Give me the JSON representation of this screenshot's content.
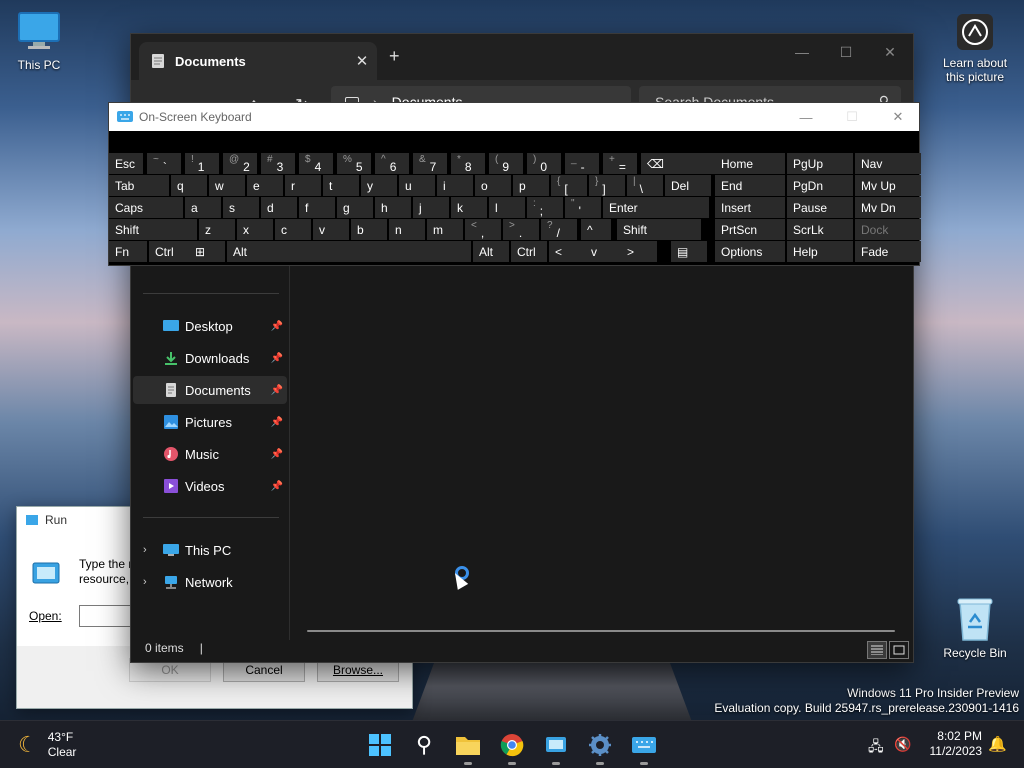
{
  "desktop": {
    "icons": {
      "this_pc": "This PC",
      "learn_picture": "Learn about this picture",
      "recycle_bin": "Recycle Bin"
    },
    "watermark": {
      "line1": "Windows 11 Pro Insider Preview",
      "line2": "Evaluation copy. Build 25947.rs_prerelease.230901-1416"
    }
  },
  "run_dialog": {
    "title": "Run",
    "description_line1": "Type the n",
    "description_line2": "resource,",
    "open_label": "Open:",
    "open_value": "",
    "ok_label": "OK",
    "cancel_label": "Cancel",
    "browse_label": "Browse..."
  },
  "explorer": {
    "tab_title": "Documents",
    "new_tab": "+",
    "address": "Documents",
    "search_placeholder": "Search Documents",
    "sidebar": {
      "quick": [
        {
          "label": "Desktop",
          "icon": "desktop-icon"
        },
        {
          "label": "Downloads",
          "icon": "download-icon"
        },
        {
          "label": "Documents",
          "icon": "document-icon",
          "active": true
        },
        {
          "label": "Pictures",
          "icon": "pictures-icon"
        },
        {
          "label": "Music",
          "icon": "music-icon"
        },
        {
          "label": "Videos",
          "icon": "videos-icon"
        }
      ],
      "roots": [
        {
          "label": "This PC",
          "icon": "this-pc-icon"
        },
        {
          "label": "Network",
          "icon": "network-icon"
        }
      ]
    },
    "status": "0 items",
    "status_sep": "|"
  },
  "osk": {
    "title": "On-Screen Keyboard",
    "rows": [
      [
        {
          "m": "Esc"
        },
        {
          "s": "~",
          "m": "`"
        },
        {
          "s": "!",
          "m": "1"
        },
        {
          "s": "@",
          "m": "2"
        },
        {
          "s": "#",
          "m": "3"
        },
        {
          "s": "$",
          "m": "4"
        },
        {
          "s": "%",
          "m": "5"
        },
        {
          "s": "^",
          "m": "6"
        },
        {
          "s": "&",
          "m": "7"
        },
        {
          "s": "*",
          "m": "8"
        },
        {
          "s": "(",
          "m": "9"
        },
        {
          "s": ")",
          "m": "0"
        },
        {
          "s": "_",
          "m": "-"
        },
        {
          "s": "+",
          "m": "="
        },
        {
          "m": "⌫"
        },
        {
          "m": "Home"
        },
        {
          "m": "PgUp"
        },
        {
          "m": "Nav"
        }
      ],
      [
        {
          "m": "Tab"
        },
        {
          "m": "q"
        },
        {
          "m": "w"
        },
        {
          "m": "e"
        },
        {
          "m": "r"
        },
        {
          "m": "t"
        },
        {
          "m": "y"
        },
        {
          "m": "u"
        },
        {
          "m": "i"
        },
        {
          "m": "o"
        },
        {
          "m": "p"
        },
        {
          "s": "{",
          "m": "["
        },
        {
          "s": "}",
          "m": "]"
        },
        {
          "s": "|",
          "m": "\\"
        },
        {
          "m": "Del"
        },
        {
          "m": "End"
        },
        {
          "m": "PgDn"
        },
        {
          "m": "Mv Up"
        }
      ],
      [
        {
          "m": "Caps"
        },
        {
          "m": "a"
        },
        {
          "m": "s"
        },
        {
          "m": "d"
        },
        {
          "m": "f"
        },
        {
          "m": "g"
        },
        {
          "m": "h"
        },
        {
          "m": "j"
        },
        {
          "m": "k"
        },
        {
          "m": "l"
        },
        {
          "s": ":",
          "m": ";"
        },
        {
          "s": "\"",
          "m": "'"
        },
        {
          "m": "Enter"
        },
        {
          "m": "Insert"
        },
        {
          "m": "Pause"
        },
        {
          "m": "Mv Dn"
        }
      ],
      [
        {
          "m": "Shift"
        },
        {
          "m": "z"
        },
        {
          "m": "x"
        },
        {
          "m": "c"
        },
        {
          "m": "v"
        },
        {
          "m": "b"
        },
        {
          "m": "n"
        },
        {
          "m": "m"
        },
        {
          "s": "<",
          "m": ","
        },
        {
          "s": ">",
          "m": "."
        },
        {
          "s": "?",
          "m": "/"
        },
        {
          "m": "^"
        },
        {
          "m": "Shift"
        },
        {
          "m": "PrtScn"
        },
        {
          "m": "ScrLk"
        },
        {
          "m": "Dock"
        }
      ],
      [
        {
          "m": "Fn"
        },
        {
          "m": "Ctrl"
        },
        {
          "m": "⊞"
        },
        {
          "m": "Alt"
        },
        {
          "m": ""
        },
        {
          "m": "Alt"
        },
        {
          "m": "Ctrl"
        },
        {
          "m": "<"
        },
        {
          "m": "v"
        },
        {
          "m": ">"
        },
        {
          "m": "▤"
        },
        {
          "m": "Options"
        },
        {
          "m": "Help"
        },
        {
          "m": "Fade"
        }
      ]
    ]
  },
  "taskbar": {
    "weather_temp": "43°F",
    "weather_desc": "Clear",
    "time": "8:02 PM",
    "date": "11/2/2023"
  }
}
